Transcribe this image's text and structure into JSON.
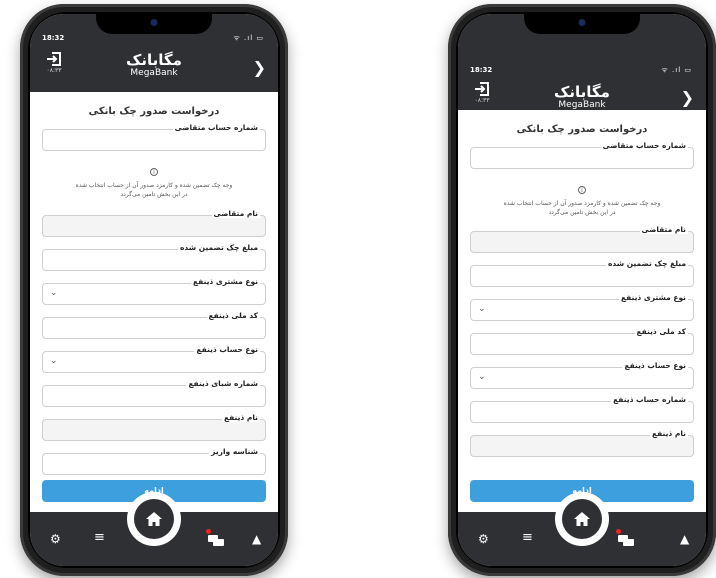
{
  "status": {
    "time": "18:32",
    "icons": "ᯤ .ıl ▭"
  },
  "header": {
    "brand_fa": "مگابانک",
    "brand_en": "MegaBank",
    "balance": "۰۸:۳۳",
    "logout_icon": "logout-icon",
    "back_icon": "chevron-right-icon"
  },
  "page": {
    "title": "درخواست صدور چک بانکی"
  },
  "info_text_1": "وجه چک تضمین شده و کارمزد صدور آن از حساب انتخاب شده",
  "info_text_2": "در این بخش تامین می‌گردد",
  "left_form": {
    "fields": [
      {
        "label": "شماره حساب متقاضی",
        "value": "",
        "placeholder": ""
      },
      {
        "label": "نام متقاضی",
        "value": "",
        "placeholder": ""
      },
      {
        "label": "مبلغ چک تضمین شده",
        "value": "",
        "placeholder": ""
      },
      {
        "label": "نوع مشتری ذینفع",
        "value": "",
        "placeholder": ""
      },
      {
        "label": "کد ملی ذینفع",
        "value": "",
        "placeholder": ""
      },
      {
        "label": "نوع حساب ذینفع",
        "value": "",
        "placeholder": ""
      },
      {
        "label": "شماره شبای ذینفع",
        "value": "",
        "placeholder": ""
      },
      {
        "label": "نام ذینفع",
        "value": "",
        "placeholder": ""
      },
      {
        "label": "شناسه واریز",
        "value": "",
        "placeholder": ""
      }
    ]
  },
  "right_form": {
    "fields": [
      {
        "label": "شماره حساب متقاضی",
        "value": "",
        "placeholder": ""
      },
      {
        "label": "نام متقاضی",
        "value": "",
        "placeholder": ""
      },
      {
        "label": "مبلغ چک تضمین شده",
        "value": "",
        "placeholder": ""
      },
      {
        "label": "نوع مشتری ذینفع",
        "value": "",
        "placeholder": ""
      },
      {
        "label": "کد ملی ذینفع",
        "value": "",
        "placeholder": ""
      },
      {
        "label": "نوع حساب ذینفع",
        "value": "",
        "placeholder": ""
      },
      {
        "label": "شماره حساب ذینفع",
        "value": "",
        "placeholder": ""
      },
      {
        "label": "نام ذینفع",
        "value": "",
        "placeholder": ""
      }
    ]
  },
  "submit_label": "ادامه",
  "nav": {
    "icons": [
      "settings-icon",
      "menu-icon",
      "home-icon",
      "messages-icon",
      "support-icon"
    ]
  },
  "colors": {
    "primary": "#3e9fdf",
    "bar": "#2e3033",
    "badge": "#e22222"
  }
}
